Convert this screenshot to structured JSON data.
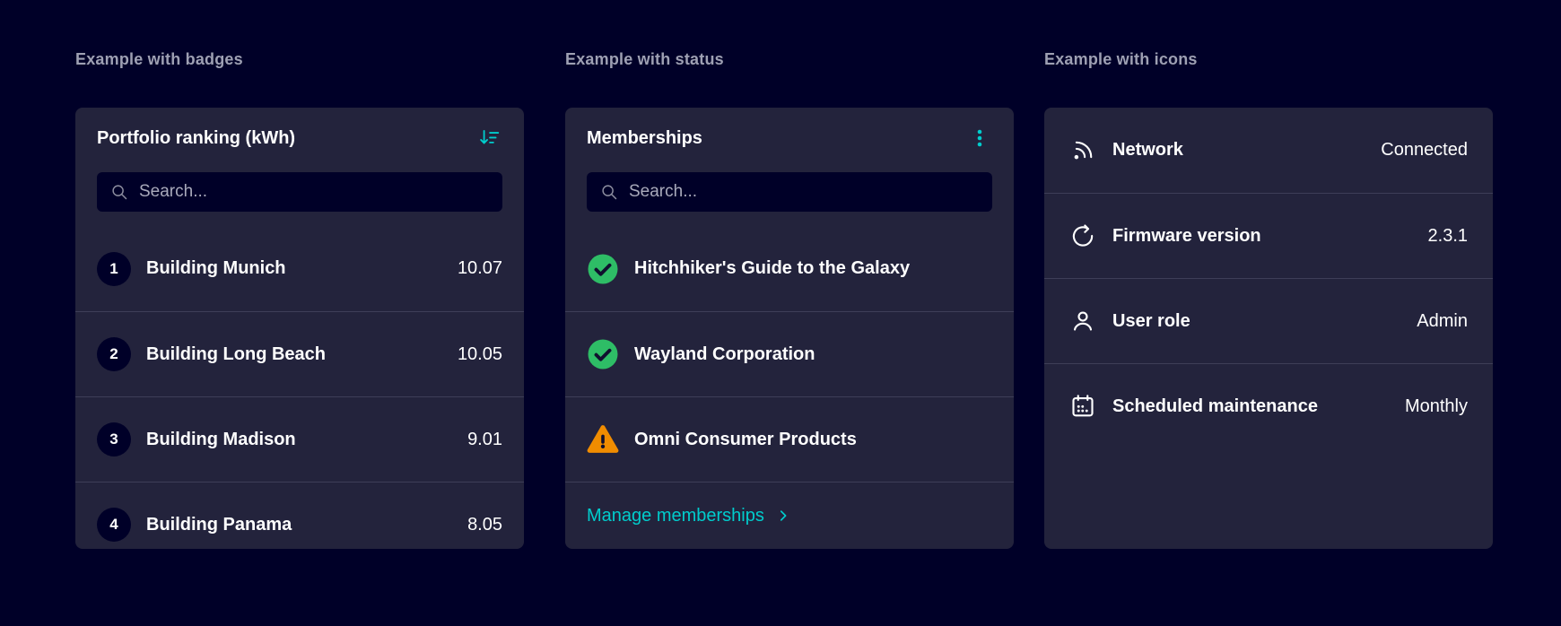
{
  "colors": {
    "page_bg": "#000028",
    "card_bg": "#23233C",
    "accent_teal": "#00CCCC",
    "status_success": "#2EBD66",
    "status_warning": "#F08C00",
    "separator": "#3e3e58",
    "section_label_text": "#9ea0b3"
  },
  "sections": [
    {
      "label": "Example with badges",
      "card": {
        "title": "Portfolio ranking (kWh)",
        "header_icon": "sort-descending-icon",
        "search": {
          "placeholder": "Search...",
          "value": ""
        },
        "items": [
          {
            "badge": "1",
            "label": "Building Munich",
            "value": "10.07"
          },
          {
            "badge": "2",
            "label": "Building Long Beach",
            "value": "10.05"
          },
          {
            "badge": "3",
            "label": "Building Madison",
            "value": "9.01"
          },
          {
            "badge": "4",
            "label": "Building Panama",
            "value": "8.05"
          }
        ]
      }
    },
    {
      "label": "Example with status",
      "card": {
        "title": "Memberships",
        "header_icon": "kebab-menu-icon",
        "search": {
          "placeholder": "Search...",
          "value": ""
        },
        "items": [
          {
            "status": "success",
            "icon": "check-circle-icon",
            "label": "Hitchhiker's Guide to the Galaxy"
          },
          {
            "status": "success",
            "icon": "check-circle-icon",
            "label": "Wayland Corporation"
          },
          {
            "status": "warning",
            "icon": "warning-triangle-icon",
            "label": "Omni Consumer Products"
          }
        ],
        "footer_link": {
          "label": "Manage memberships",
          "icon": "chevron-right-icon"
        }
      }
    },
    {
      "label": "Example with icons",
      "card": {
        "items": [
          {
            "icon": "network-icon",
            "label": "Network",
            "value": "Connected"
          },
          {
            "icon": "refresh-icon",
            "label": "Firmware version",
            "value": "2.3.1"
          },
          {
            "icon": "user-icon",
            "label": "User role",
            "value": "Admin"
          },
          {
            "icon": "calendar-icon",
            "label": "Scheduled maintenance",
            "value": "Monthly"
          }
        ]
      }
    }
  ]
}
